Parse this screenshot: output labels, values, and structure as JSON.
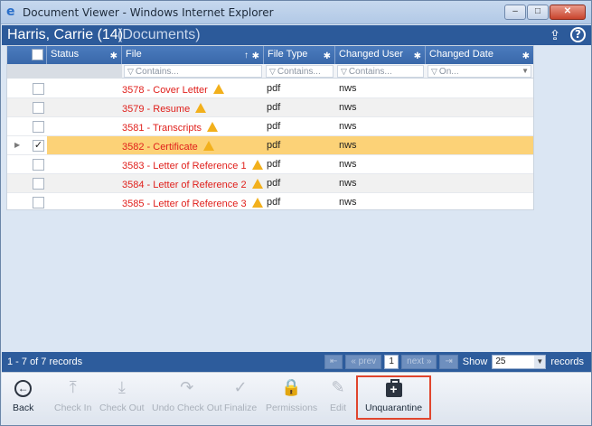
{
  "window": {
    "title": "Document Viewer - Windows Internet Explorer",
    "min": "–",
    "max": "□",
    "close": "✕"
  },
  "header": {
    "name": "Harris, Carrie (14)",
    "section": "(Documents)"
  },
  "columns": [
    {
      "label": "Status"
    },
    {
      "label": "File"
    },
    {
      "label": "File Type"
    },
    {
      "label": "Changed User"
    },
    {
      "label": "Changed Date"
    }
  ],
  "filters": {
    "file": "Contains...",
    "type": "Contains...",
    "user": "Contains...",
    "date": "On..."
  },
  "rows": [
    {
      "file": "3578 - Cover Letter",
      "type": "pdf",
      "user": "nws",
      "checked": false
    },
    {
      "file": "3579 - Resume",
      "type": "pdf",
      "user": "nws",
      "checked": false
    },
    {
      "file": "3581 - Transcripts",
      "type": "pdf",
      "user": "nws",
      "checked": false
    },
    {
      "file": "3582 - Certificate",
      "type": "pdf",
      "user": "nws",
      "checked": true
    },
    {
      "file": "3583 - Letter of Reference 1",
      "type": "pdf",
      "user": "nws",
      "checked": false
    },
    {
      "file": "3584 - Letter of Reference 2",
      "type": "pdf",
      "user": "nws",
      "checked": false
    },
    {
      "file": "3585 - Letter of Reference 3",
      "type": "pdf",
      "user": "nws",
      "checked": false
    }
  ],
  "status": {
    "count": "1 - 7 of 7 records",
    "prev": "« prev",
    "page": "1",
    "next": "next »",
    "show_label": "Show",
    "show_value": "25",
    "records_label": "records"
  },
  "toolbar": {
    "back": "Back",
    "check_in": "Check In",
    "check_out": "Check Out",
    "undo_check_out": "Undo Check Out",
    "finalize": "Finalize",
    "permissions": "Permissions",
    "edit": "Edit",
    "unquarantine": "Unquarantine"
  },
  "colors": {
    "accent": "#2c5a9a",
    "link_red": "#e0201c",
    "selected_row": "#fcd277",
    "highlight_border": "#e0452d"
  }
}
